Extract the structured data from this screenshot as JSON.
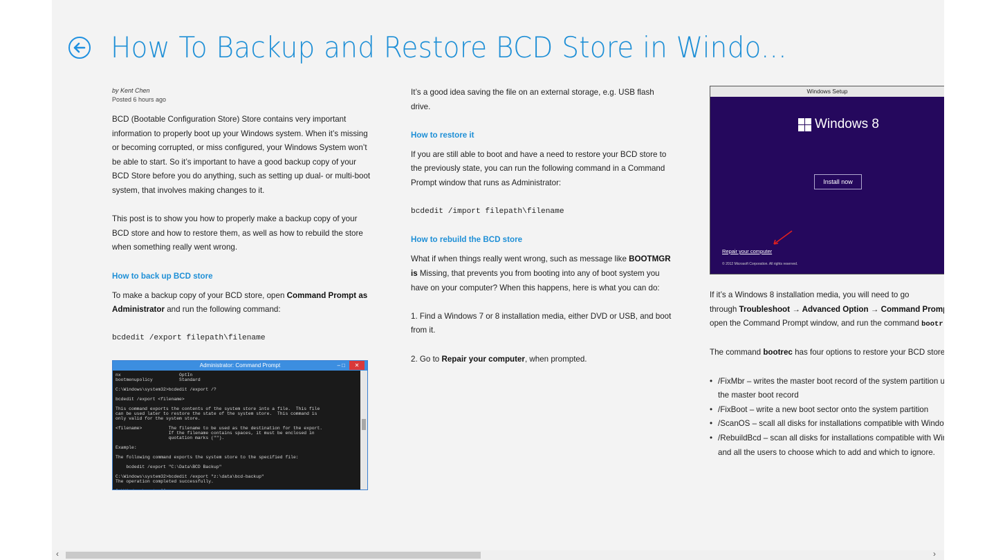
{
  "header": {
    "title": "How To Backup and Restore BCD Store in Windo..."
  },
  "article": {
    "byline": "by Kent Chen",
    "posted": "Posted 6 hours ago",
    "intro_p1": "BCD (Bootable Configuration Store) Store contains very important information to properly boot up your Windows system. When it’s missing or becoming corrupted, or miss configured, your Windows System won’t be able to start. So it’s important to have a good backup copy of your BCD Store before you do anything, such as setting up dual- or multi-boot system, that involves making changes to it.",
    "intro_p2": "This post is to show you how to properly make a backup copy of your BCD store and how to restore them, as well as how to rebuild the store when something really went wrong.",
    "h_backup": "How to back up BCD store",
    "backup_pre": "To make a backup copy of your BCD store, open ",
    "backup_bold": "Command Prompt as Administrator",
    "backup_post": " and run the following command:",
    "backup_cmd": "bcdedit /export filepath\\filename",
    "save_tip": "It’s a good idea saving the file on an external storage, e.g. USB flash drive.",
    "h_restore": "How to restore it",
    "restore_text": "If you are still able to boot and have a need to restore your BCD store to the previously state, you can run the following command in a Command Prompt window that runs as Administrator:",
    "restore_cmd": "bcdedit /import filepath\\filename",
    "h_rebuild": "How to rebuild the BCD store",
    "rebuild_pre": "What if when things really went wrong, such as message like ",
    "rebuild_bold": "BOOTMGR is",
    "rebuild_post": " Missing, that prevents you from booting into any of boot system you have on your computer? When this happens, here is what you can do:",
    "step1": "1. Find a Windows 7 or 8 installation media, either DVD or USB, and boot from it.",
    "step2_pre": "2. Go to ",
    "step2_bold": "Repair your computer",
    "step2_post": ", when prompted.",
    "install_pre": "If it’s a Windows 8 installation media, you will need to go",
    "install_l2_pre": "through ",
    "install_l2_bold": "Troubleshoot → Advanced Option → Command Promp",
    "install_l3_pre": "open the Command Prompt window, and run the command ",
    "install_l3_code": "bootr",
    "bootrec_pre": "The command ",
    "bootrec_bold": "bootrec",
    "bootrec_post": " has four options to restore your BCD store:",
    "opt1a": "/FixMbr – writes the master boot record of the system partition u",
    "opt1b": "the master boot record",
    "opt2": "/FixBoot – write a new boot sector onto the system partition",
    "opt3": "/ScanOS – scall all disks for installations compatible with Window",
    "opt4a": "/RebuildBcd – scan all disks for installations compatible with Win",
    "opt4b": "and all the users to choose which to add and which to ignore."
  },
  "cmd_screenshot": {
    "title": "Administrator: Command Prompt",
    "controls": "–  □",
    "close": "✕",
    "lines": "nx                      OptIn\nbootmenupolicy          Standard\n\nC:\\Windows\\system32>bcdedit /export /?\n\nbcdedit /export <filename>\n\nThis command exports the contents of the system store into a file.  This file\ncan be used later to restore the state of the system store.  This command is\nonly valid for the system store.\n\n<filename>          The filename to be used as the destination for the export.\n                    If the filename contains spaces, it must be enclosed in\n                    quotation marks (\"\").\n\nExample:\n\nThe following command exports the system store to the specified file:\n\n    bcdedit /export \"C:\\Data\\BCD Backup\"\n\nC:\\Windows\\system32>bcdedit /export \"z:\\data\\bcd-backup\"\nThe operation completed successfully.\n\nC:\\Windows\\system32>"
  },
  "setup_screenshot": {
    "title": "Windows Setup",
    "logo_text": "Windows 8",
    "install_label": "Install now",
    "repair_label": "Repair your computer",
    "copyright": "© 2012 Microsoft Corporation. All rights reserved."
  },
  "scrollbar": {
    "left_arrow": "‹",
    "right_arrow": "›"
  },
  "colors": {
    "accent": "#1e8fd6",
    "background": "#f3f3f3",
    "setup_bg": "#25085d"
  }
}
